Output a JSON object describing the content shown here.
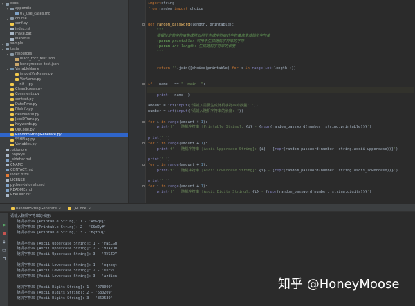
{
  "tree": [
    {
      "depth": 0,
      "arrow": "▾",
      "icon": "folder",
      "label": "docs"
    },
    {
      "depth": 1,
      "arrow": "▾",
      "icon": "folder",
      "label": "appendix"
    },
    {
      "depth": 2,
      "arrow": "",
      "icon": "md",
      "label": "07_use_cases.md"
    },
    {
      "depth": 1,
      "arrow": "▸",
      "icon": "folder",
      "label": "course"
    },
    {
      "depth": 1,
      "arrow": "",
      "icon": "py",
      "label": "conf.py"
    },
    {
      "depth": 1,
      "arrow": "",
      "icon": "file",
      "label": "index.rst"
    },
    {
      "depth": 1,
      "arrow": "",
      "icon": "file",
      "label": "make.bat"
    },
    {
      "depth": 1,
      "arrow": "",
      "icon": "file",
      "label": "Makefile"
    },
    {
      "depth": 0,
      "arrow": "▸",
      "icon": "folder",
      "label": "sample"
    },
    {
      "depth": 0,
      "arrow": "▾",
      "icon": "folder",
      "label": "tests"
    },
    {
      "depth": 1,
      "arrow": "▾",
      "icon": "folder",
      "label": "resources"
    },
    {
      "depth": 2,
      "arrow": "",
      "icon": "json",
      "label": "black_rock_test.json"
    },
    {
      "depth": 2,
      "arrow": "",
      "icon": "json",
      "label": "honeymoose_test.json"
    },
    {
      "depth": 1,
      "arrow": "▾",
      "icon": "pkg",
      "label": "VariableName"
    },
    {
      "depth": 2,
      "arrow": "",
      "icon": "py",
      "label": "importVarName.py"
    },
    {
      "depth": 2,
      "arrow": "",
      "icon": "py",
      "label": "VarName.py"
    },
    {
      "depth": 1,
      "arrow": "",
      "icon": "py",
      "label": "__init__.py"
    },
    {
      "depth": 1,
      "arrow": "",
      "icon": "py",
      "label": "CleanScreen.py"
    },
    {
      "depth": 1,
      "arrow": "",
      "icon": "py",
      "label": "Comments.py"
    },
    {
      "depth": 1,
      "arrow": "",
      "icon": "py",
      "label": "context.py"
    },
    {
      "depth": 1,
      "arrow": "",
      "icon": "py",
      "label": "DateTime.py"
    },
    {
      "depth": 1,
      "arrow": "",
      "icon": "py",
      "label": "FileInfo.py"
    },
    {
      "depth": 1,
      "arrow": "",
      "icon": "py",
      "label": "HelloWorld.py"
    },
    {
      "depth": 1,
      "arrow": "",
      "icon": "py",
      "label": "JsonDTrans.py"
    },
    {
      "depth": 1,
      "arrow": "",
      "icon": "py",
      "label": "Keywords.py"
    },
    {
      "depth": 1,
      "arrow": "",
      "icon": "py",
      "label": "QRCode.py"
    },
    {
      "depth": 1,
      "arrow": "",
      "icon": "py",
      "label": "RandomStringGenerate.py",
      "selected": true
    },
    {
      "depth": 1,
      "arrow": "",
      "icon": "py",
      "label": "SSHFlag.py"
    },
    {
      "depth": 1,
      "arrow": "",
      "icon": "py",
      "label": "Variables.py"
    },
    {
      "depth": 0,
      "arrow": "",
      "icon": "file",
      "label": ".gitignore"
    },
    {
      "depth": 0,
      "arrow": "",
      "icon": "file",
      "label": ".nojekyll"
    },
    {
      "depth": 0,
      "arrow": "",
      "icon": "md",
      "label": "_sidebar.md"
    },
    {
      "depth": 0,
      "arrow": "",
      "icon": "file",
      "label": "CNAME"
    },
    {
      "depth": 0,
      "arrow": "",
      "icon": "md",
      "label": "CONTACT.md"
    },
    {
      "depth": 0,
      "arrow": "",
      "icon": "html",
      "label": "index.html"
    },
    {
      "depth": 0,
      "arrow": "",
      "icon": "file",
      "label": "LICENSE"
    },
    {
      "depth": 0,
      "arrow": "",
      "icon": "md",
      "label": "python-tutorials.md"
    },
    {
      "depth": 0,
      "arrow": "",
      "icon": "md",
      "label": "README.md"
    },
    {
      "depth": 0,
      "arrow": "",
      "icon": "file",
      "label": "README.rst"
    }
  ],
  "code": [
    [
      [
        "kw",
        "import"
      ],
      [
        "",
        "string"
      ]
    ],
    [
      [
        "kw",
        "from"
      ],
      [
        "",
        " random "
      ],
      [
        "kw",
        "import"
      ],
      [
        "",
        " choice"
      ]
    ],
    [],
    [],
    [
      [
        "kw",
        "def "
      ],
      [
        "fn",
        "random_password"
      ],
      [
        "",
        "(length, printable):"
      ]
    ],
    [
      [
        "doc",
        "    \"\"\""
      ]
    ],
    [
      [
        "doc",
        "    根据给定的字符串生成可以用于生成字符串的字符集来生成随机字符串"
      ]
    ],
    [
      [
        "doc",
        "    "
      ],
      [
        "tagk",
        ":param"
      ],
      [
        "doc",
        " printable: 可用于生成随机字符串的字符"
      ]
    ],
    [
      [
        "doc",
        "    "
      ],
      [
        "tagk",
        ":param"
      ],
      [
        "doc",
        " int length: 生成随机字符串的长度"
      ]
    ],
    [
      [
        "doc",
        "    \"\"\""
      ]
    ],
    [],
    [
      [
        "",
        ""
      ]
    ],
    [
      [
        "kw",
        "    return "
      ],
      [
        "str",
        "''"
      ],
      [
        "",
        ".join([choice(printable) "
      ],
      [
        "kw",
        "for"
      ],
      [
        "",
        " x "
      ],
      [
        "kw",
        "in "
      ],
      [
        "bi",
        "range"
      ],
      [
        "",
        "("
      ],
      [
        "bi",
        "int"
      ],
      [
        "",
        "(length))])"
      ]
    ],
    [],
    [],
    [
      [
        "kw",
        "if "
      ],
      [
        "",
        "__name__ == "
      ],
      [
        "str",
        "\"__main__\""
      ],
      [
        "",
        ":"
      ]
    ],
    [
      [
        "",
        "    "
      ]
    ],
    [
      [
        "",
        "    "
      ],
      [
        "bi",
        "print"
      ],
      [
        "",
        "(__name__)"
      ]
    ],
    [],
    [
      [
        "",
        "amount = "
      ],
      [
        "bi",
        "int"
      ],
      [
        "",
        "("
      ],
      [
        "bi",
        "input"
      ],
      [
        "",
        "("
      ],
      [
        "str",
        "'请输入需要生成随机字符串的数量: '"
      ],
      [
        "",
        "))"
      ]
    ],
    [
      [
        "",
        "number = "
      ],
      [
        "bi",
        "int"
      ],
      [
        "",
        "("
      ],
      [
        "bi",
        "input"
      ],
      [
        "",
        "("
      ],
      [
        "str",
        "'请输入随机字符串的长度: '"
      ],
      [
        "",
        "))"
      ]
    ],
    [],
    [
      [
        "kw",
        "for "
      ],
      [
        "",
        "i "
      ],
      [
        "kw",
        "in "
      ],
      [
        "bi",
        "range"
      ],
      [
        "",
        "(amount + "
      ],
      [
        "num",
        "1"
      ],
      [
        "",
        "):"
      ]
    ],
    [
      [
        "",
        "    "
      ],
      [
        "bi",
        "print"
      ],
      [
        "",
        "("
      ],
      [
        "str",
        "f'   随机字符串 [Printable String]: "
      ],
      [
        "",
        "{i}"
      ],
      [
        "str",
        " - "
      ],
      [
        "",
        "{"
      ],
      [
        "bi",
        "repr"
      ],
      [
        "",
        "(random_password(number, string.printable))}"
      ],
      [
        "str",
        "'"
      ],
      [
        "",
        ")"
      ]
    ],
    [],
    [
      [
        "bi",
        "print"
      ],
      [
        "",
        "("
      ],
      [
        "str",
        "' '"
      ],
      [
        "",
        ")"
      ]
    ],
    [
      [
        "kw",
        "for "
      ],
      [
        "",
        "i "
      ],
      [
        "kw",
        "in "
      ],
      [
        "bi",
        "range"
      ],
      [
        "",
        "(amount + "
      ],
      [
        "num",
        "1"
      ],
      [
        "",
        "):"
      ]
    ],
    [
      [
        "",
        "    "
      ],
      [
        "bi",
        "print"
      ],
      [
        "",
        "("
      ],
      [
        "str",
        "f'   随机字符串 [Ascii Uppercase String]: "
      ],
      [
        "",
        "{i}"
      ],
      [
        "str",
        " - "
      ],
      [
        "",
        "{"
      ],
      [
        "bi",
        "repr"
      ],
      [
        "",
        "(random_password(number, string.ascii_uppercase))}"
      ],
      [
        "str",
        "'"
      ],
      [
        "",
        ")"
      ]
    ],
    [],
    [
      [
        "bi",
        "print"
      ],
      [
        "",
        "("
      ],
      [
        "str",
        "' '"
      ],
      [
        "",
        ")"
      ]
    ],
    [
      [
        "kw",
        "for "
      ],
      [
        "",
        "i "
      ],
      [
        "kw",
        "in "
      ],
      [
        "bi",
        "range"
      ],
      [
        "",
        "(amount + "
      ],
      [
        "num",
        "1"
      ],
      [
        "",
        "):"
      ]
    ],
    [
      [
        "",
        "    "
      ],
      [
        "bi",
        "print"
      ],
      [
        "",
        "("
      ],
      [
        "str",
        "f'   随机字符串 [Ascii Lowercase String]: "
      ],
      [
        "",
        "{i}"
      ],
      [
        "str",
        " - "
      ],
      [
        "",
        "{"
      ],
      [
        "bi",
        "repr"
      ],
      [
        "",
        "(random_password(number, string.ascii_lowercase))}"
      ],
      [
        "str",
        "'"
      ],
      [
        "",
        ")"
      ]
    ],
    [],
    [
      [
        "bi",
        "print"
      ],
      [
        "",
        "("
      ],
      [
        "str",
        "' '"
      ],
      [
        "",
        ")"
      ]
    ],
    [
      [
        "kw",
        "for "
      ],
      [
        "",
        "i "
      ],
      [
        "kw",
        "in "
      ],
      [
        "bi",
        "range"
      ],
      [
        "",
        "(amount + "
      ],
      [
        "num",
        "1"
      ],
      [
        "",
        "):"
      ]
    ],
    [
      [
        "",
        "    "
      ],
      [
        "bi",
        "print"
      ],
      [
        "",
        "("
      ],
      [
        "str",
        "f'   随机字符串 [Ascii Digits String]: "
      ],
      [
        "",
        "{i}"
      ],
      [
        "str",
        " - "
      ],
      [
        "",
        "{"
      ],
      [
        "bi",
        "repr"
      ],
      [
        "",
        "(random_password(number, string.digits))}"
      ],
      [
        "str",
        "'"
      ],
      [
        "",
        ")"
      ]
    ]
  ],
  "run_tabs": [
    "RandomStringGenerate",
    "QRCode"
  ],
  "console": [
    "请输入随机字符串的长度：",
    "   随机字符串 [Printable String]: 1 - 'Rt&qs['",
    "   随机字符串 [Printable String]: 2 - 'CSdJy#'",
    "   随机字符串 [Printable String]: 3 - 'b{fnu{'",
    "",
    "   随机字符串 [Ascii Uppercase String]: 1 - 'YNZLGM'",
    "   随机字符串 [Ascii Uppercase String]: 2 - 'BJAROU'",
    "   随机字符串 [Ascii Uppercase String]: 3 - 'RVSZOY'",
    "",
    "   随机字符串 [Ascii Lowercase String]: 1 - 'ognbqt'",
    "   随机字符串 [Ascii Lowercase String]: 2 - 'survll'",
    "   随机字符串 [Ascii Lowercase String]: 3 - 'uzdion'",
    "",
    "   随机字符串 [Ascii Digits String]: 1 - '273099'",
    "   随机字符串 [Ascii Digits String]: 2 - '580209'",
    "   随机字符串 [Ascii Digits String]: 3 - '869539'"
  ],
  "watermark": "知乎 @HoneyMoose"
}
